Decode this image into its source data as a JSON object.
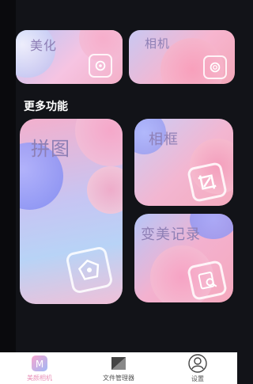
{
  "cards": {
    "beautify": "美化",
    "camera": "相机",
    "collage": "拼图",
    "frame": "相框",
    "history": "变美记录"
  },
  "section_title": "更多功能",
  "tabbar": {
    "items": [
      {
        "label": "美颜相机",
        "icon": "app-logo-icon"
      },
      {
        "label": "文件管理器",
        "icon": "folder-icon"
      },
      {
        "label": "设置",
        "icon": "user-icon"
      }
    ]
  },
  "colors": {
    "background": "#121318",
    "accent_pink": "#f59bc4",
    "accent_blue": "#8bb2f5"
  }
}
